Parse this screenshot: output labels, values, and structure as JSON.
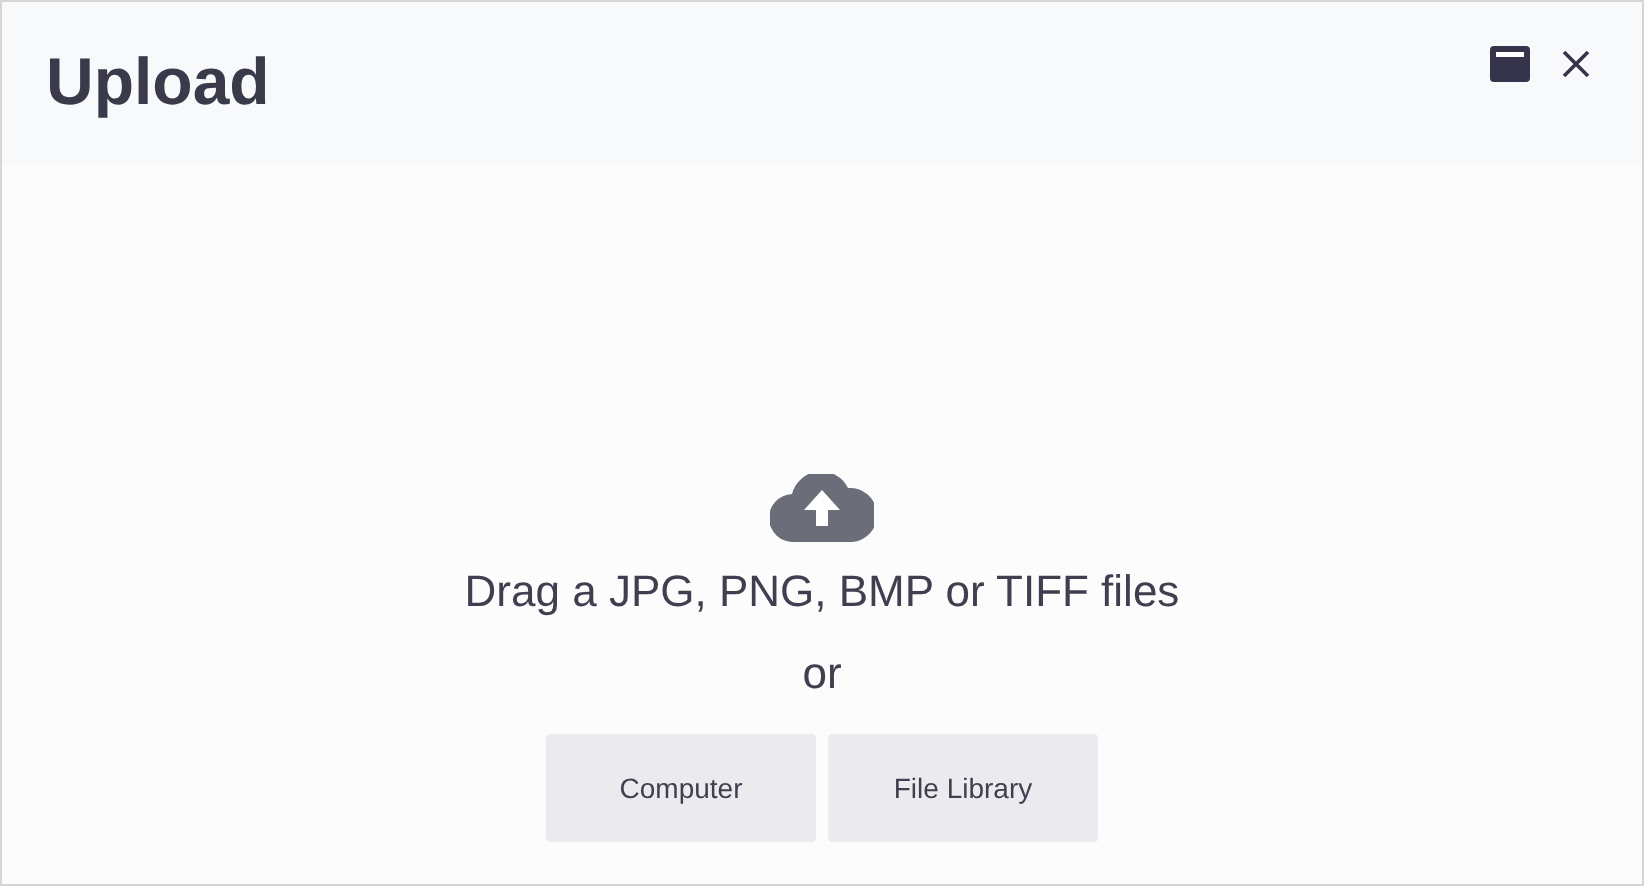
{
  "dialog": {
    "title": "Upload"
  },
  "dropzone": {
    "instruction": "Drag a JPG, PNG, BMP or TIFF files",
    "separator": "or"
  },
  "buttons": [
    {
      "label": "Computer"
    },
    {
      "label": "File Library"
    }
  ]
}
